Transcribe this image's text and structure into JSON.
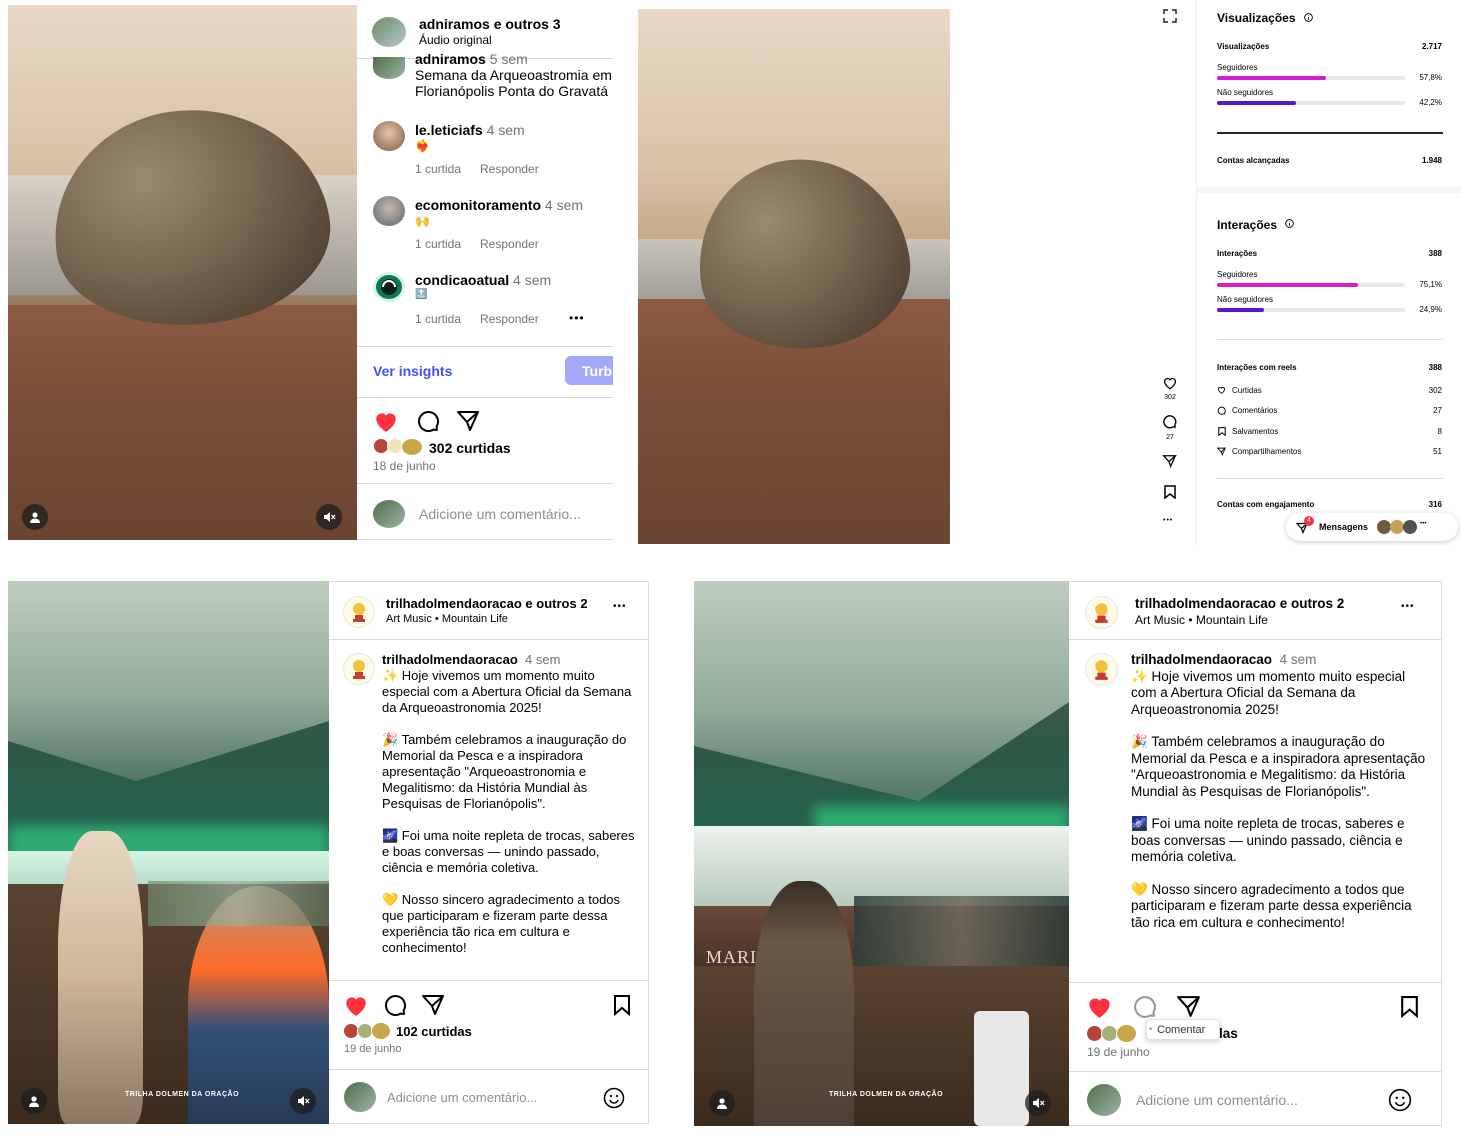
{
  "top_left_post": {
    "header": {
      "username": "adniramos e outros 3",
      "audio": "Áudio original"
    },
    "first_comment": {
      "user": "adniramos",
      "time": "5 sem",
      "text_line1": "Semana da Arqueoastromia em",
      "text_line2": "Florianópolis Ponta do Gravatá"
    },
    "comments": [
      {
        "user": "le.leticiafs",
        "time": "4 sem",
        "emoji": "❤️‍🔥",
        "likes": "1 curtida",
        "reply": "Responder"
      },
      {
        "user": "ecomonitoramento",
        "time": "4 sem",
        "emoji": "🙌",
        "likes": "1 curtida",
        "reply": "Responder"
      },
      {
        "user": "condicaoatual",
        "time": "4 sem",
        "emoji": "🔝",
        "likes": "1 curtida",
        "reply": "Responder",
        "more": "•••"
      }
    ],
    "insights_link": "Ver insights",
    "boost_button": "Turb",
    "likes": "302 curtidas",
    "date": "18 de junho",
    "comment_placeholder": "Adicione um comentário..."
  },
  "reel_side_actions": {
    "likes": "302",
    "comments": "27",
    "more": "•••"
  },
  "insights": {
    "views_title": "Visualizações",
    "views_label": "Visualizações",
    "views_value": "2.717",
    "views_breakdown": [
      {
        "label": "Seguidores",
        "percent_text": "57,8%",
        "percent": 57.8,
        "color": "#d41cd6"
      },
      {
        "label": "Não seguidores",
        "percent_text": "42,2%",
        "percent": 42.2,
        "color": "#5a17c9"
      }
    ],
    "reached_label": "Contas alcançadas",
    "reached_value": "1.948",
    "interactions_title": "Interações",
    "interactions_label": "Interações",
    "interactions_value": "388",
    "interactions_breakdown": [
      {
        "label": "Seguidores",
        "percent_text": "75,1%",
        "percent": 75.1,
        "color": "#d41cd6"
      },
      {
        "label": "Não seguidores",
        "percent_text": "24,9%",
        "percent": 24.9,
        "color": "#5a17c9"
      }
    ],
    "reel_interactions_label": "Interações com reels",
    "reel_interactions_value": "388",
    "reel_items": [
      {
        "icon": "heart-icon",
        "label": "Curtidas",
        "value": "302"
      },
      {
        "icon": "comment-icon",
        "label": "Comentários",
        "value": "27"
      },
      {
        "icon": "bookmark-icon",
        "label": "Salvamentos",
        "value": "8"
      },
      {
        "icon": "share-icon",
        "label": "Compartilhamentos",
        "value": "51"
      }
    ],
    "engaged_label": "Contas com engajamento",
    "engaged_value": "316",
    "messages_label": "Mensagens",
    "messages_badge": "4",
    "messages_more": "•••"
  },
  "bottom_left_post": {
    "username": "trilhadolmendaoracao e outros 2",
    "music": "Art Music",
    "music_sep": "•",
    "music_title": "Mountain Life",
    "more": "•••",
    "author": "trilhadolmendaoracao",
    "time": "4 sem",
    "caption": [
      "✨ Hoje vivemos um momento muito especial com a Abertura Oficial da Semana da Arqueoastronomia 2025!",
      "🎉 Também celebramos a inauguração do Memorial da Pesca e a inspiradora apresentação \"Arqueoastronomia e Megalitismo: da História Mundial às Pesquisas de Florianópolis\".",
      "🌌 Foi uma noite repleta de trocas, saberes e boas conversas — unindo passado, ciência e memória coletiva.",
      "💛 Nosso sincero agradecimento a todos que participaram e fizeram parte dessa experiência tão rica em cultura e conhecimento!"
    ],
    "likes": "102 curtidas",
    "date": "19 de junho",
    "comment_placeholder": "Adicione um comentário...",
    "watermark": "TRILHA DOLMEN DA ORAÇÃO"
  },
  "bottom_right_post": {
    "username": "trilhadolmendaoracao e outros 2",
    "music": "Art Music",
    "music_sep": "•",
    "music_title": "Mountain Life",
    "more": "•••",
    "author": "trilhadolmendaoracao",
    "time": "4 sem",
    "caption": [
      "✨ Hoje vivemos um momento muito especial com a Abertura Oficial da Semana da Arqueoastronomia 2025!",
      "🎉 Também celebramos a inauguração do Memorial da Pesca e a inspiradora apresentação \"Arqueoastronomia e Megalitismo: da História Mundial às Pesquisas de Florianópolis\".",
      "🌌 Foi uma noite repleta de trocas, saberes e boas conversas — unindo passado, ciência e memória coletiva.",
      "💛 Nosso sincero agradecimento a todos que participaram e fizeram parte dessa experiência tão rica em cultura e conhecimento!"
    ],
    "tooltip": "Comentar",
    "likes_partial": "las",
    "date": "19 de junho",
    "comment_placeholder": "Adicione um comentário...",
    "watermark": "TRILHA DOLMEN DA ORAÇÃO",
    "boat_text": "MARIS"
  }
}
